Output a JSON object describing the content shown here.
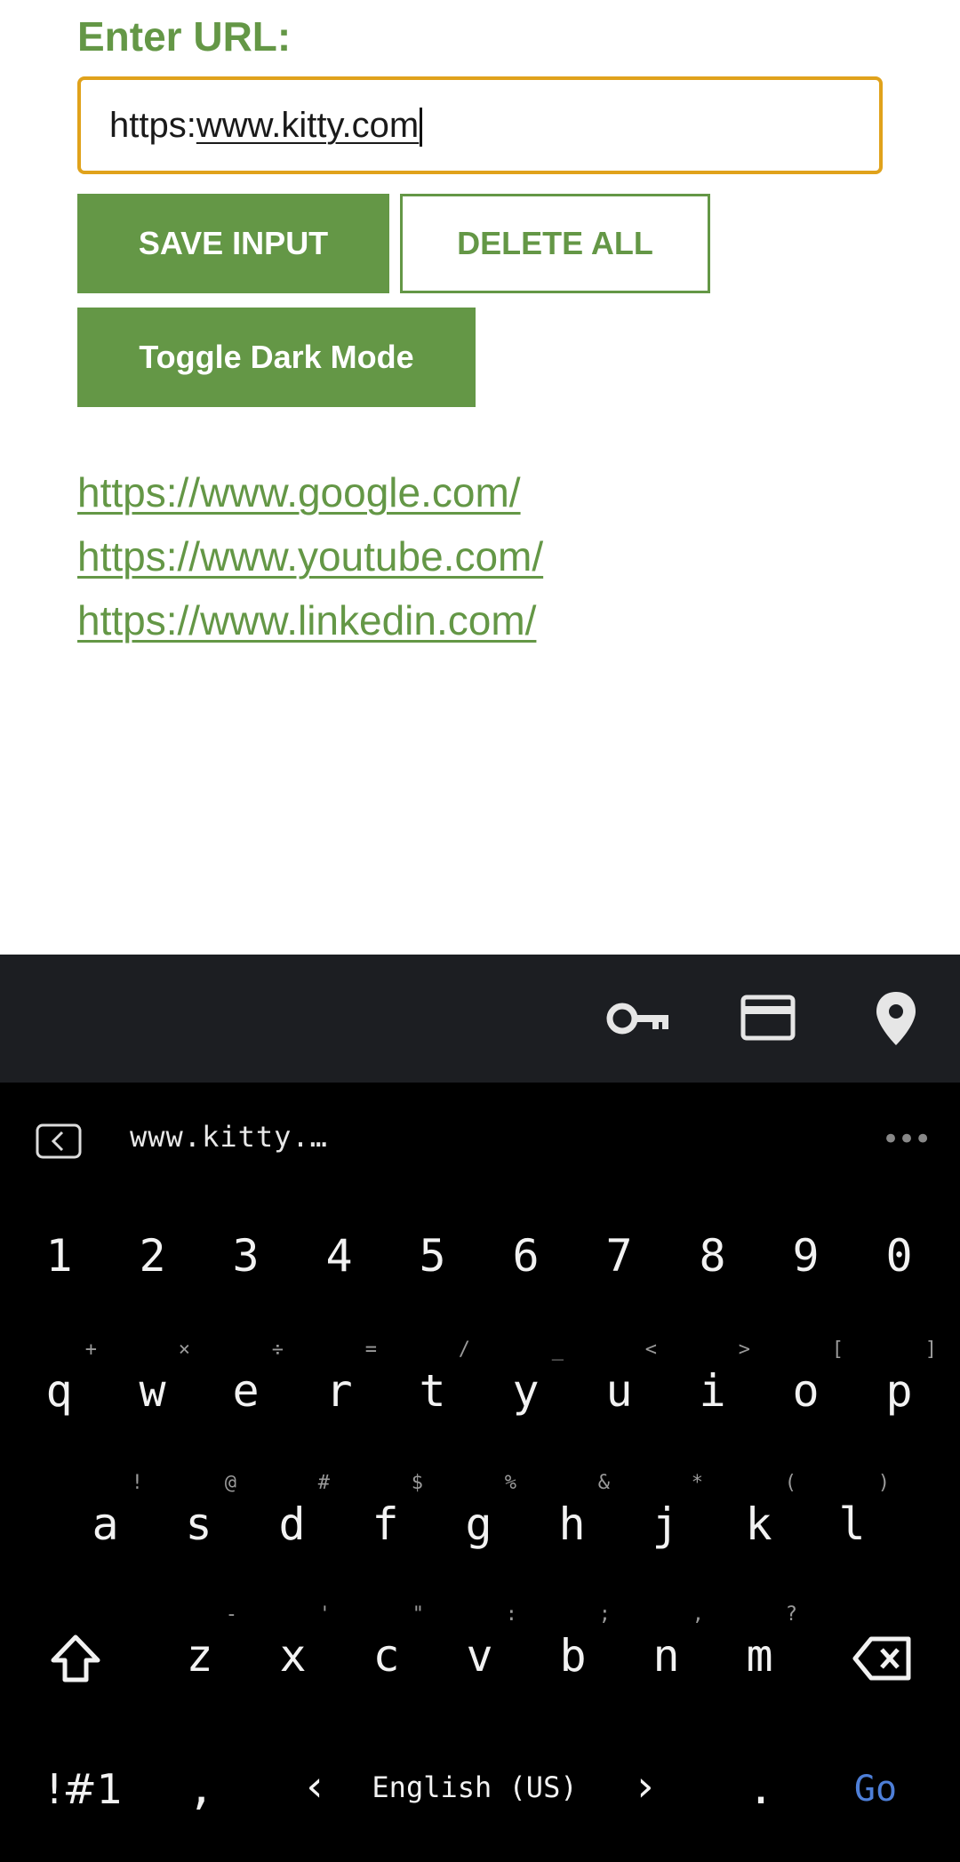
{
  "form": {
    "label": "Enter URL:",
    "input_prefix": "https:",
    "input_underlined": "www.kitty.com",
    "save_label": "SAVE INPUT",
    "delete_label": "DELETE ALL",
    "toggle_label": "Toggle Dark Mode"
  },
  "links": [
    "https://www.google.com/",
    "https://www.youtube.com/",
    "https://www.linkedin.com/"
  ],
  "autofill_bar": {
    "icons": [
      "key-icon",
      "credit-card-icon",
      "location-pin-icon"
    ]
  },
  "keyboard": {
    "suggestion": "www.kitty.…",
    "more": "•••",
    "number_row": [
      "1",
      "2",
      "3",
      "4",
      "5",
      "6",
      "7",
      "8",
      "9",
      "0"
    ],
    "row1": [
      {
        "k": "q",
        "h": "+"
      },
      {
        "k": "w",
        "h": "×"
      },
      {
        "k": "e",
        "h": "÷"
      },
      {
        "k": "r",
        "h": "="
      },
      {
        "k": "t",
        "h": "/"
      },
      {
        "k": "y",
        "h": "_"
      },
      {
        "k": "u",
        "h": "<"
      },
      {
        "k": "i",
        "h": ">"
      },
      {
        "k": "o",
        "h": "["
      },
      {
        "k": "p",
        "h": "]"
      }
    ],
    "row2": [
      {
        "k": "a",
        "h": "!"
      },
      {
        "k": "s",
        "h": "@"
      },
      {
        "k": "d",
        "h": "#"
      },
      {
        "k": "f",
        "h": "$"
      },
      {
        "k": "g",
        "h": "%"
      },
      {
        "k": "h",
        "h": "&"
      },
      {
        "k": "j",
        "h": "*"
      },
      {
        "k": "k",
        "h": "("
      },
      {
        "k": "l",
        "h": ")"
      }
    ],
    "row3": [
      {
        "k": "z",
        "h": "-"
      },
      {
        "k": "x",
        "h": "'"
      },
      {
        "k": "c",
        "h": "\""
      },
      {
        "k": "v",
        "h": ":"
      },
      {
        "k": "b",
        "h": ";"
      },
      {
        "k": "n",
        "h": ","
      },
      {
        "k": "m",
        "h": "?"
      }
    ],
    "symbols_label": "!#1",
    "comma": ",",
    "language": "English (US)",
    "lang_prev": "‹",
    "lang_next": "›",
    "period": ".",
    "go_label": "Go",
    "go_color": "#4e7fd8"
  }
}
